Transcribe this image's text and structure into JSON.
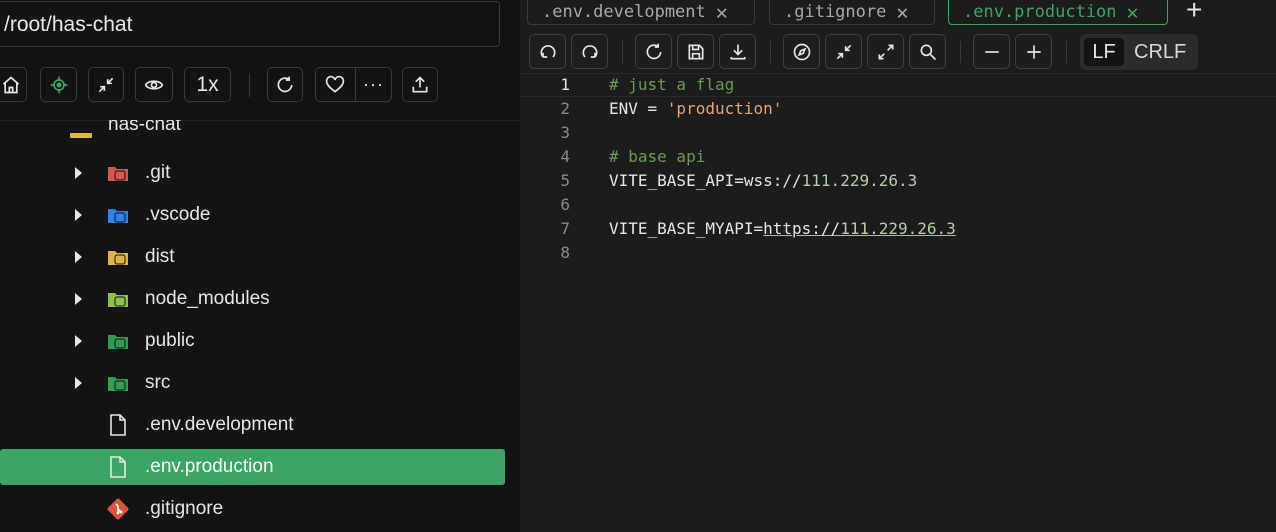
{
  "explorer": {
    "path": "/root/has-chat",
    "speed_label": "1x",
    "root_folder": "has-chat",
    "items": [
      {
        "name": ".git",
        "type": "folder",
        "icon": "git-folder-icon",
        "color": "#d9534f"
      },
      {
        "name": ".vscode",
        "type": "folder",
        "icon": "vscode-folder-icon",
        "color": "#2f80ed"
      },
      {
        "name": "dist",
        "type": "folder",
        "icon": "dist-folder-icon",
        "color": "#e0b642"
      },
      {
        "name": "node_modules",
        "type": "folder",
        "icon": "node-folder-icon",
        "color": "#8bc34a"
      },
      {
        "name": "public",
        "type": "folder",
        "icon": "public-folder-icon",
        "color": "#2e9e4f"
      },
      {
        "name": "src",
        "type": "folder",
        "icon": "src-folder-icon",
        "color": "#2e9e4f"
      },
      {
        "name": ".env.development",
        "type": "file",
        "icon": "file-icon"
      },
      {
        "name": ".env.production",
        "type": "file",
        "icon": "file-icon",
        "selected": true
      },
      {
        "name": ".gitignore",
        "type": "file",
        "icon": "git-file-icon",
        "color": "#e2513a"
      }
    ]
  },
  "editor": {
    "tabs": [
      {
        "label": ".env.development",
        "active": false
      },
      {
        "label": ".gitignore",
        "active": false
      },
      {
        "label": ".env.production",
        "active": true
      }
    ],
    "eol": {
      "lf": "LF",
      "crlf": "CRLF",
      "selected": "LF"
    },
    "active_line": 1,
    "lines": [
      {
        "n": "1",
        "text": "# just a flag"
      },
      {
        "n": "2",
        "text": "ENV = 'production'"
      },
      {
        "n": "3",
        "text": ""
      },
      {
        "n": "4",
        "text": "# base api"
      },
      {
        "n": "5",
        "text": "VITE_BASE_API=wss://111.229.26.3"
      },
      {
        "n": "6",
        "text": ""
      },
      {
        "n": "7",
        "text": "VITE_BASE_MYAPI=https://111.229.26.3"
      },
      {
        "n": "8",
        "text": ""
      }
    ]
  },
  "colors": {
    "accent": "#3ba664",
    "comment": "#6a9955",
    "string": "#e8a27b",
    "number": "#b5cea8"
  }
}
